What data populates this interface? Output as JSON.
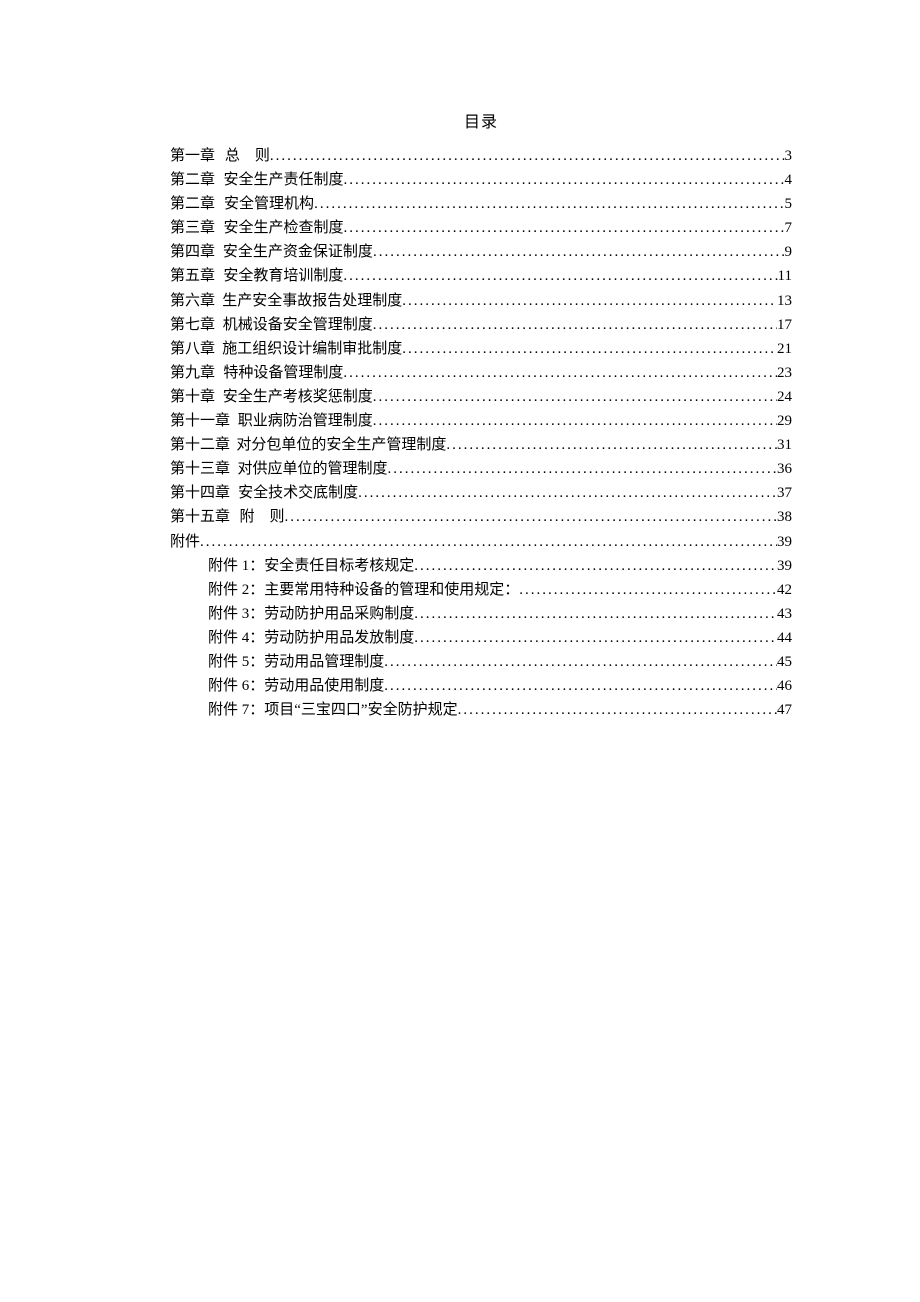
{
  "title": "目录",
  "entries": [
    {
      "chapter": "第一章",
      "title": "总　则",
      "page": "3",
      "indent": 0
    },
    {
      "chapter": "第二章",
      "title": "安全生产责任制度",
      "page": "4",
      "indent": 0
    },
    {
      "chapter": "第二章",
      "title": "安全管理机构",
      "page": "5",
      "indent": 0
    },
    {
      "chapter": "第三章",
      "title": "安全生产检查制度",
      "page": "7",
      "indent": 0
    },
    {
      "chapter": "第四章",
      "title": "安全生产资金保证制度",
      "page": "9",
      "indent": 0
    },
    {
      "chapter": "第五章",
      "title": "安全教育培训制度",
      "page": "11",
      "indent": 0
    },
    {
      "chapter": "第六章",
      "title": "生产安全事故报告处理制度",
      "page": "13",
      "indent": 0
    },
    {
      "chapter": "第七章",
      "title": "机械设备安全管理制度",
      "page": "17",
      "indent": 0
    },
    {
      "chapter": "第八章",
      "title": "施工组织设计编制审批制度",
      "page": "21",
      "indent": 0
    },
    {
      "chapter": "第九章",
      "title": "特种设备管理制度",
      "page": "23",
      "indent": 0
    },
    {
      "chapter": "第十章",
      "title": "安全生产考核奖惩制度",
      "page": "24",
      "indent": 0
    },
    {
      "chapter": "第十一章",
      "title": "职业病防治管理制度",
      "page": "29",
      "indent": 0
    },
    {
      "chapter": "第十二章",
      "title": "对分包单位的安全生产管理制度",
      "page": "31",
      "indent": 0
    },
    {
      "chapter": "第十三章",
      "title": "对供应单位的管理制度",
      "page": "36",
      "indent": 0
    },
    {
      "chapter": "第十四章",
      "title": "安全技术交底制度",
      "page": "37",
      "indent": 0
    },
    {
      "chapter": "第十五章",
      "title": "附　则",
      "page": "38",
      "indent": 0
    },
    {
      "chapter": "附件",
      "title": "",
      "page": "39",
      "indent": 0,
      "nogap": true
    },
    {
      "chapter": "附件 1：",
      "title": "安全责任目标考核规定",
      "page": "39",
      "indent": 1,
      "nogap": true
    },
    {
      "chapter": "附件 2：",
      "title": "主要常用特种设备的管理和使用规定：",
      "page": "42",
      "indent": 1,
      "nogap": true
    },
    {
      "chapter": "附件 3：",
      "title": "劳动防护用品采购制度",
      "page": "43",
      "indent": 1,
      "nogap": true
    },
    {
      "chapter": "附件 4：",
      "title": "劳动防护用品发放制度",
      "page": "44",
      "indent": 1,
      "nogap": true
    },
    {
      "chapter": "附件 5：",
      "title": "劳动用品管理制度",
      "page": "45",
      "indent": 1,
      "nogap": true
    },
    {
      "chapter": "附件 6：",
      "title": "劳动用品使用制度",
      "page": "46",
      "indent": 1,
      "nogap": true
    },
    {
      "chapter": "附件 7：",
      "title": "项目“三宝四口”安全防护规定",
      "page": "47",
      "indent": 1,
      "nogap": true
    }
  ]
}
